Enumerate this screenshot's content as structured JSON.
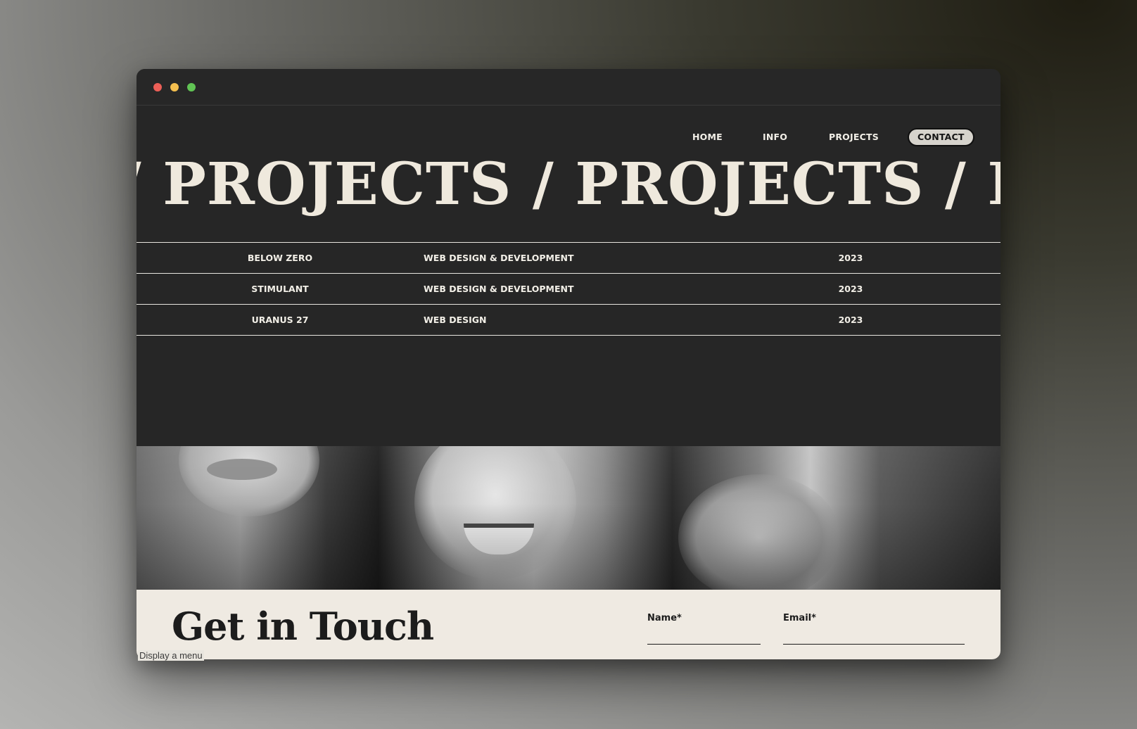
{
  "window": {
    "traffic_lights": {
      "close": "#ec5f57",
      "minimize": "#f4bf4f",
      "zoom": "#61c454"
    }
  },
  "nav": {
    "home": "HOME",
    "info": "INFO",
    "projects": "PROJECTS",
    "contact": "CONTACT"
  },
  "hero": {
    "marquee_text": "S / PROJECTS / PROJECTS / PROJECTS"
  },
  "projects": [
    {
      "name": "BELOW ZERO",
      "type": "WEB DESIGN & DEVELOPMENT",
      "year": "2023"
    },
    {
      "name": "STIMULANT",
      "type": "WEB DESIGN & DEVELOPMENT",
      "year": "2023"
    },
    {
      "name": "URANUS 27",
      "type": "WEB DESIGN",
      "year": "2023"
    }
  ],
  "contact": {
    "title": "Get in Touch",
    "name_label": "Name*",
    "email_label": "Email*"
  },
  "tooltip": "Display a menu",
  "colors": {
    "page_bg": "#262626",
    "text_light": "#efe9dd",
    "contact_bg": "#efeae2",
    "contact_btn_bg": "#d6d3cc"
  }
}
